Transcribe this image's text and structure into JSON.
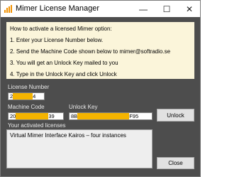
{
  "window": {
    "title": "Mimer License Manager",
    "icon": "bar-chart-icon",
    "controls": {
      "minimize": "—",
      "maximize": "☐",
      "close": "✕"
    }
  },
  "instructions": {
    "lines": [
      "How to activate a licensed Mimer option:",
      "1. Enter your License Number below.",
      "2. Send the Machine Code shown below to mimer@softradio.se",
      "3. You will get an Unlock Key mailed to you",
      "4. Type in the Unlock Key and click Unlock"
    ]
  },
  "license_number": {
    "label": "License Number",
    "value_prefix": "2",
    "value_suffix": "4"
  },
  "machine_code": {
    "label": "Machine Code",
    "value_prefix": "20",
    "value_suffix": "39"
  },
  "unlock_key": {
    "label": "Unlock Key",
    "value_prefix": "8B",
    "value_suffix": "F95"
  },
  "buttons": {
    "unlock": "Unlock",
    "close": "Close"
  },
  "licenses": {
    "label": "Your activated licenses",
    "items": [
      "Virtual Mimer Interface Kairos – four instances"
    ]
  },
  "colors": {
    "redaction": "#f5b400",
    "instructions_bg": "#fbf5da",
    "window_bg": "#4d4d4d"
  }
}
